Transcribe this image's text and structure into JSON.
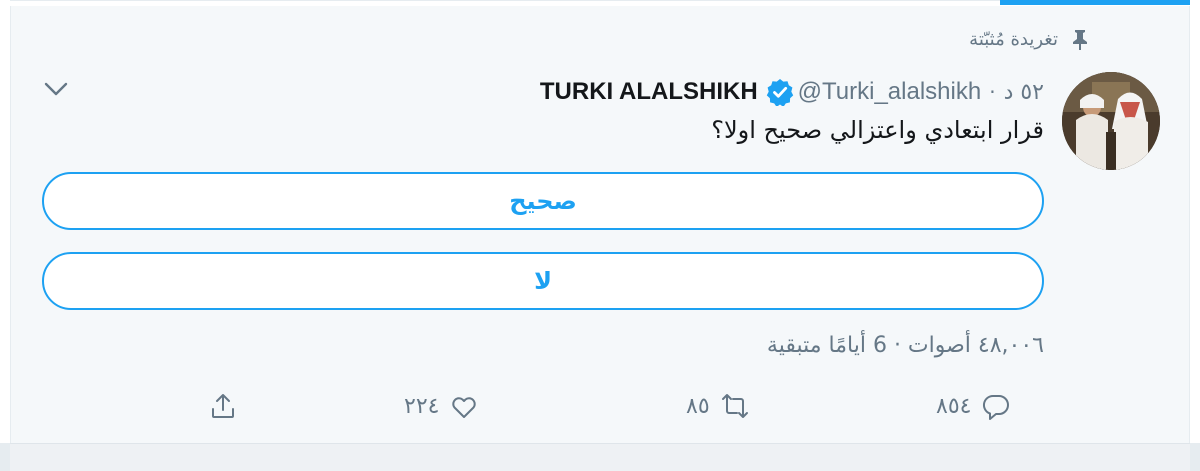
{
  "pinned": {
    "label": "تغريدة مُثبّتة"
  },
  "tweet": {
    "author_name": "TURKI ALALSHIKH",
    "handle": "@Turki_alalshikh",
    "time": "٥٢ د",
    "text": "قرار ابتعادي واعتزالي صحيح اولا؟"
  },
  "poll": {
    "options": [
      {
        "label": "صحيح"
      },
      {
        "label": "لا"
      }
    ],
    "meta": "٤٨,٠٠٦ أصوات · 6 أيامًا متبقية"
  },
  "actions": {
    "reply_count": "٨٥٤",
    "retweet_count": "٨٥",
    "like_count": "٢٢٤"
  },
  "colors": {
    "accent": "#1da1f2",
    "secondary_text": "#657786",
    "card_background": "#f5f8fa"
  },
  "icons": [
    "pin-icon",
    "verified-icon",
    "chevron-down-icon",
    "reply-icon",
    "retweet-icon",
    "like-icon",
    "share-icon"
  ]
}
